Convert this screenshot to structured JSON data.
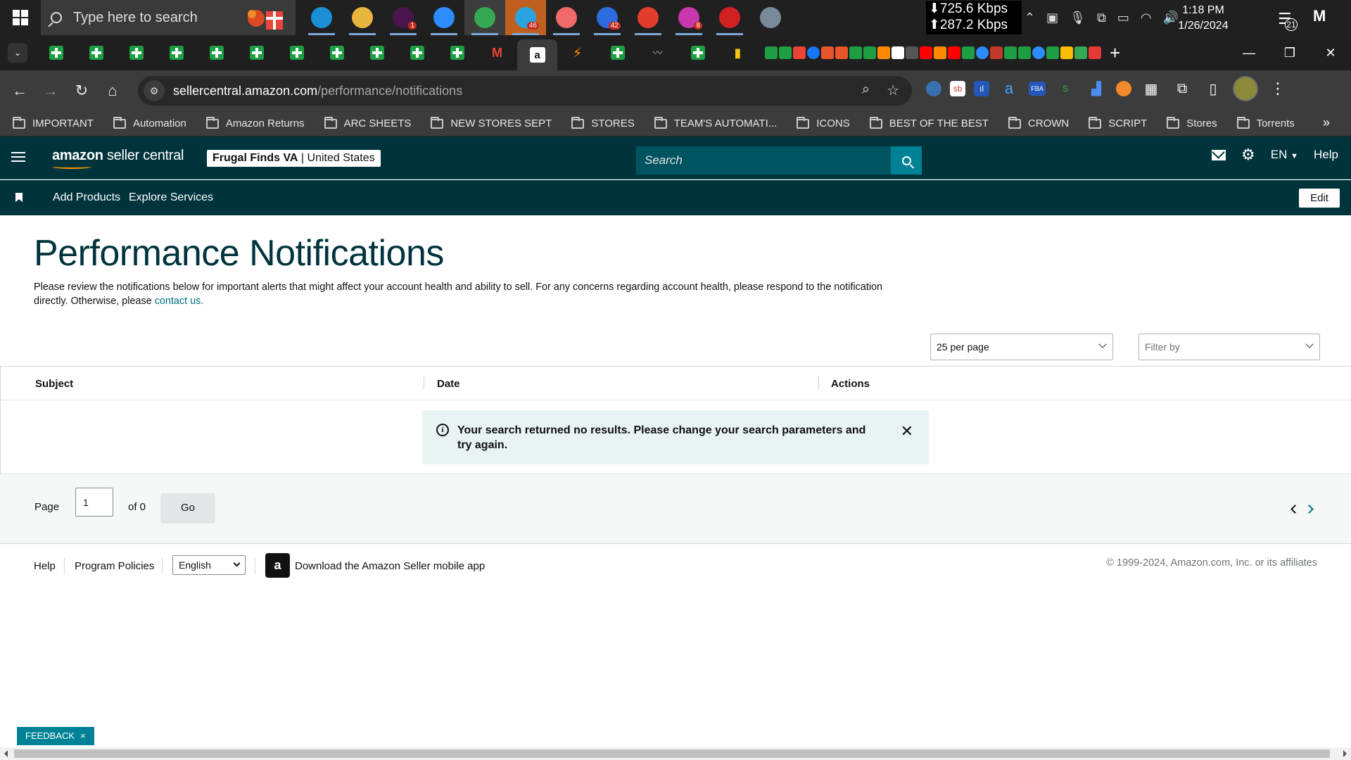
{
  "taskbar": {
    "search_placeholder": "Type here to search",
    "net_down": "⬇725.6 Kbps",
    "net_up": "⬆287.2 Kbps",
    "time": "1:18 PM",
    "date": "1/26/2024",
    "notification_count": "21",
    "apps": [
      {
        "icon": "edge-icon",
        "color": "#1b8fd6",
        "badge": ""
      },
      {
        "icon": "file-explorer-icon",
        "color": "#e8b53d",
        "badge": ""
      },
      {
        "icon": "slack-icon",
        "color": "#4a154b",
        "badge": "1"
      },
      {
        "icon": "zoom-icon",
        "color": "#2d8cff",
        "badge": ""
      },
      {
        "icon": "chrome-icon",
        "color": "#34a853",
        "badge": ""
      },
      {
        "icon": "telegram-icon",
        "color": "#2aa3df",
        "badge": "46"
      },
      {
        "icon": "asana-icon",
        "color": "#f06a6a",
        "badge": ""
      },
      {
        "icon": "messenger-icon",
        "color": "#2d6cdf",
        "badge": "42"
      },
      {
        "icon": "media-player-icon",
        "color": "#e23c2c",
        "badge": ""
      },
      {
        "icon": "messenger-alt-icon",
        "color": "#c837ab",
        "badge": "8"
      },
      {
        "icon": "psiphon-icon",
        "color": "#d02020",
        "badge": ""
      },
      {
        "icon": "calculator-icon",
        "color": "#7a8a9a",
        "badge": ""
      }
    ]
  },
  "browser": {
    "url_host": "sellercentral.amazon.com",
    "url_path": "/performance/notifications",
    "bookmarks": [
      "IMPORTANT",
      "Automation",
      "Amazon Returns",
      "ARC SHEETS",
      "NEW STORES SEPT",
      "STORES",
      "TEAM'S AUTOMATI...",
      "ICONS",
      "BEST OF THE BEST",
      "CROWN",
      "SCRIPT",
      "Stores",
      "Torrents"
    ],
    "more_bookmarks": "»"
  },
  "header": {
    "logo_amazon": "amazon",
    "logo_suffix": " seller central",
    "store_name": "Frugal Finds VA",
    "store_separator": " | ",
    "store_country": "United States",
    "search_placeholder": "Search",
    "language": "EN",
    "help": "Help"
  },
  "subnav": {
    "add_products": "Add Products",
    "explore_services": "Explore Services",
    "edit": "Edit"
  },
  "page": {
    "title": "Performance Notifications",
    "intro": "Please review the notifications below for important alerts that might affect your account health and ability to sell. For any concerns regarding account health, please respond to the notification directly. Otherwise, please ",
    "contact_link": "contact us.",
    "per_page": "25 per page",
    "filter_placeholder": "Filter by"
  },
  "table": {
    "columns": [
      "Subject",
      "Date",
      "Actions"
    ],
    "empty_message": "Your search returned no results. Please change your search parameters and try again."
  },
  "pagination": {
    "page_label": "Page",
    "current_page": "1",
    "of_label": "of 0",
    "go": "Go"
  },
  "footer": {
    "help": "Help",
    "program_policies": "Program Policies",
    "language": "English",
    "download_app": "Download the Amazon Seller mobile app",
    "copyright": "© 1999-2024, Amazon.com, Inc. or its affiliates"
  },
  "feedback": {
    "label": "FEEDBACK",
    "close": "×"
  }
}
